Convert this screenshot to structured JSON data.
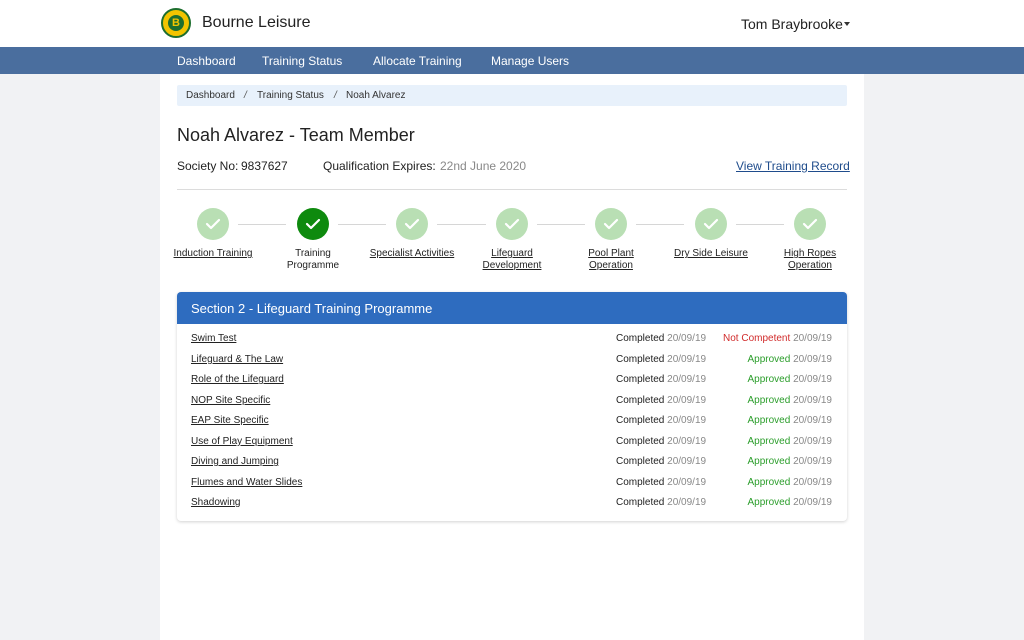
{
  "header": {
    "brand": "Bourne Leisure",
    "logo_letter": "B",
    "user_name": "Tom Braybrooke"
  },
  "nav": {
    "items": [
      "Dashboard",
      "Training Status",
      "Allocate Training",
      "Manage Users"
    ]
  },
  "breadcrumb": {
    "items": [
      "Dashboard",
      "Training Status",
      "Noah Alvarez"
    ],
    "separator": "/"
  },
  "profile": {
    "title": "Noah Alvarez  - Team Member",
    "society_label": "Society No:",
    "society_no": "9837627",
    "qual_label": "Qualification Expires:",
    "qual_date": "22nd June 2020",
    "view_record": "View Training Record"
  },
  "steps": [
    {
      "label": "Induction Training",
      "state": "complete"
    },
    {
      "label": "Training Programme",
      "state": "active"
    },
    {
      "label": "Specialist Activities",
      "state": "complete"
    },
    {
      "label": "Lifeguard Development",
      "state": "complete"
    },
    {
      "label": "Pool Plant Operation",
      "state": "complete"
    },
    {
      "label": "Dry Side Leisure",
      "state": "complete"
    },
    {
      "label": "High Ropes Operation",
      "state": "complete"
    }
  ],
  "section": {
    "title": "Section 2 - Lifeguard Training Programme",
    "rows": [
      {
        "name": "Swim Test",
        "completed": "Completed",
        "completed_date": "20/09/19",
        "status": "Not Competent",
        "status_date": "20/09/19",
        "status_type": "failed"
      },
      {
        "name": "Lifeguard & The Law",
        "completed": "Completed",
        "completed_date": "20/09/19",
        "status": "Approved",
        "status_date": "20/09/19",
        "status_type": "approved"
      },
      {
        "name": "Role of the Lifeguard",
        "completed": "Completed",
        "completed_date": "20/09/19",
        "status": "Approved",
        "status_date": "20/09/19",
        "status_type": "approved"
      },
      {
        "name": "NOP Site Specific",
        "completed": "Completed",
        "completed_date": "20/09/19",
        "status": "Approved",
        "status_date": "20/09/19",
        "status_type": "approved"
      },
      {
        "name": "EAP Site Specific",
        "completed": "Completed",
        "completed_date": "20/09/19",
        "status": "Approved",
        "status_date": "20/09/19",
        "status_type": "approved"
      },
      {
        "name": "Use of Play Equipment",
        "completed": "Completed",
        "completed_date": "20/09/19",
        "status": "Approved",
        "status_date": "20/09/19",
        "status_type": "approved"
      },
      {
        "name": "Diving and Jumping",
        "completed": "Completed",
        "completed_date": "20/09/19",
        "status": "Approved",
        "status_date": "20/09/19",
        "status_type": "approved"
      },
      {
        "name": "Flumes and Water Slides",
        "completed": "Completed",
        "completed_date": "20/09/19",
        "status": "Approved",
        "status_date": "20/09/19",
        "status_type": "approved"
      },
      {
        "name": "Shadowing",
        "completed": "Completed",
        "completed_date": "20/09/19",
        "status": "Approved",
        "status_date": "20/09/19",
        "status_type": "approved"
      }
    ]
  },
  "colors": {
    "nav_bg": "#4a6e9e",
    "card_header": "#2e6cbf",
    "step_complete": "#b9dfb4",
    "step_active": "#0e8a0e",
    "approved": "#2a9d2a",
    "not_competent": "#d12b2b"
  },
  "icons": {
    "logo": "bourne-leisure-logo",
    "caret": "caret-down-icon",
    "step": "check-icon"
  }
}
